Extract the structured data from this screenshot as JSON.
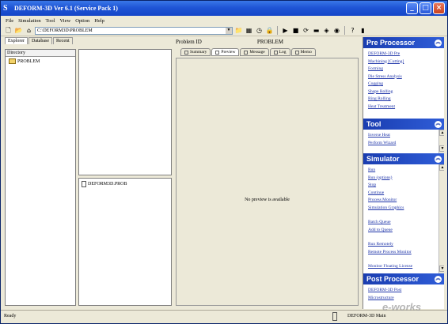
{
  "window": {
    "title": "DEFORM-3D  Ver 6.1 (Service Pack 1)",
    "min": "_",
    "max": "□",
    "close": "×"
  },
  "menu": [
    "File",
    "Simulation",
    "Tool",
    "View",
    "Option",
    "Help"
  ],
  "toolbar": {
    "path": "C:\\DEFORM3D\\PROBLEM"
  },
  "left": {
    "tabs": [
      "Explorer",
      "Database",
      "Recent"
    ],
    "dir_header": "Directory",
    "tree_item": "PROBLEM",
    "file_item": "DEFORM3D.PROB"
  },
  "center": {
    "pid_label": "Problem ID",
    "pid_value": "PROBLEM",
    "tabs": [
      "Summary",
      "Preview",
      "Message",
      "Log",
      "Memo"
    ],
    "preview_msg": "No preview is available"
  },
  "right": {
    "pre": {
      "title": "Pre Processor",
      "items": [
        "DEFORM-3D Pre",
        "Machining [Cutting]",
        "Forming",
        "Die Stress Analysis",
        "Cogging",
        "Shape Rolling",
        "Ring Rolling",
        "Heat Treatment"
      ]
    },
    "tool": {
      "title": "Tool",
      "items": [
        "Inverse Heat",
        "Perform Wizard"
      ]
    },
    "sim": {
      "title": "Simulator",
      "items": [
        "Run",
        "Run (options)",
        "Stop",
        "Continue",
        "Process Monitor",
        "Simulation Graphics",
        "Batch Queue",
        "Add to Queue",
        "Run Remotely",
        "Remote Process Monitor",
        "Monitor Floating License"
      ]
    },
    "post": {
      "title": "Post Processor",
      "items": [
        "DEFORM-3D Post",
        "Microstructure"
      ]
    }
  },
  "status": {
    "left": "Ready",
    "right": "DEFORM-3D     Main"
  },
  "watermark": "e-works"
}
